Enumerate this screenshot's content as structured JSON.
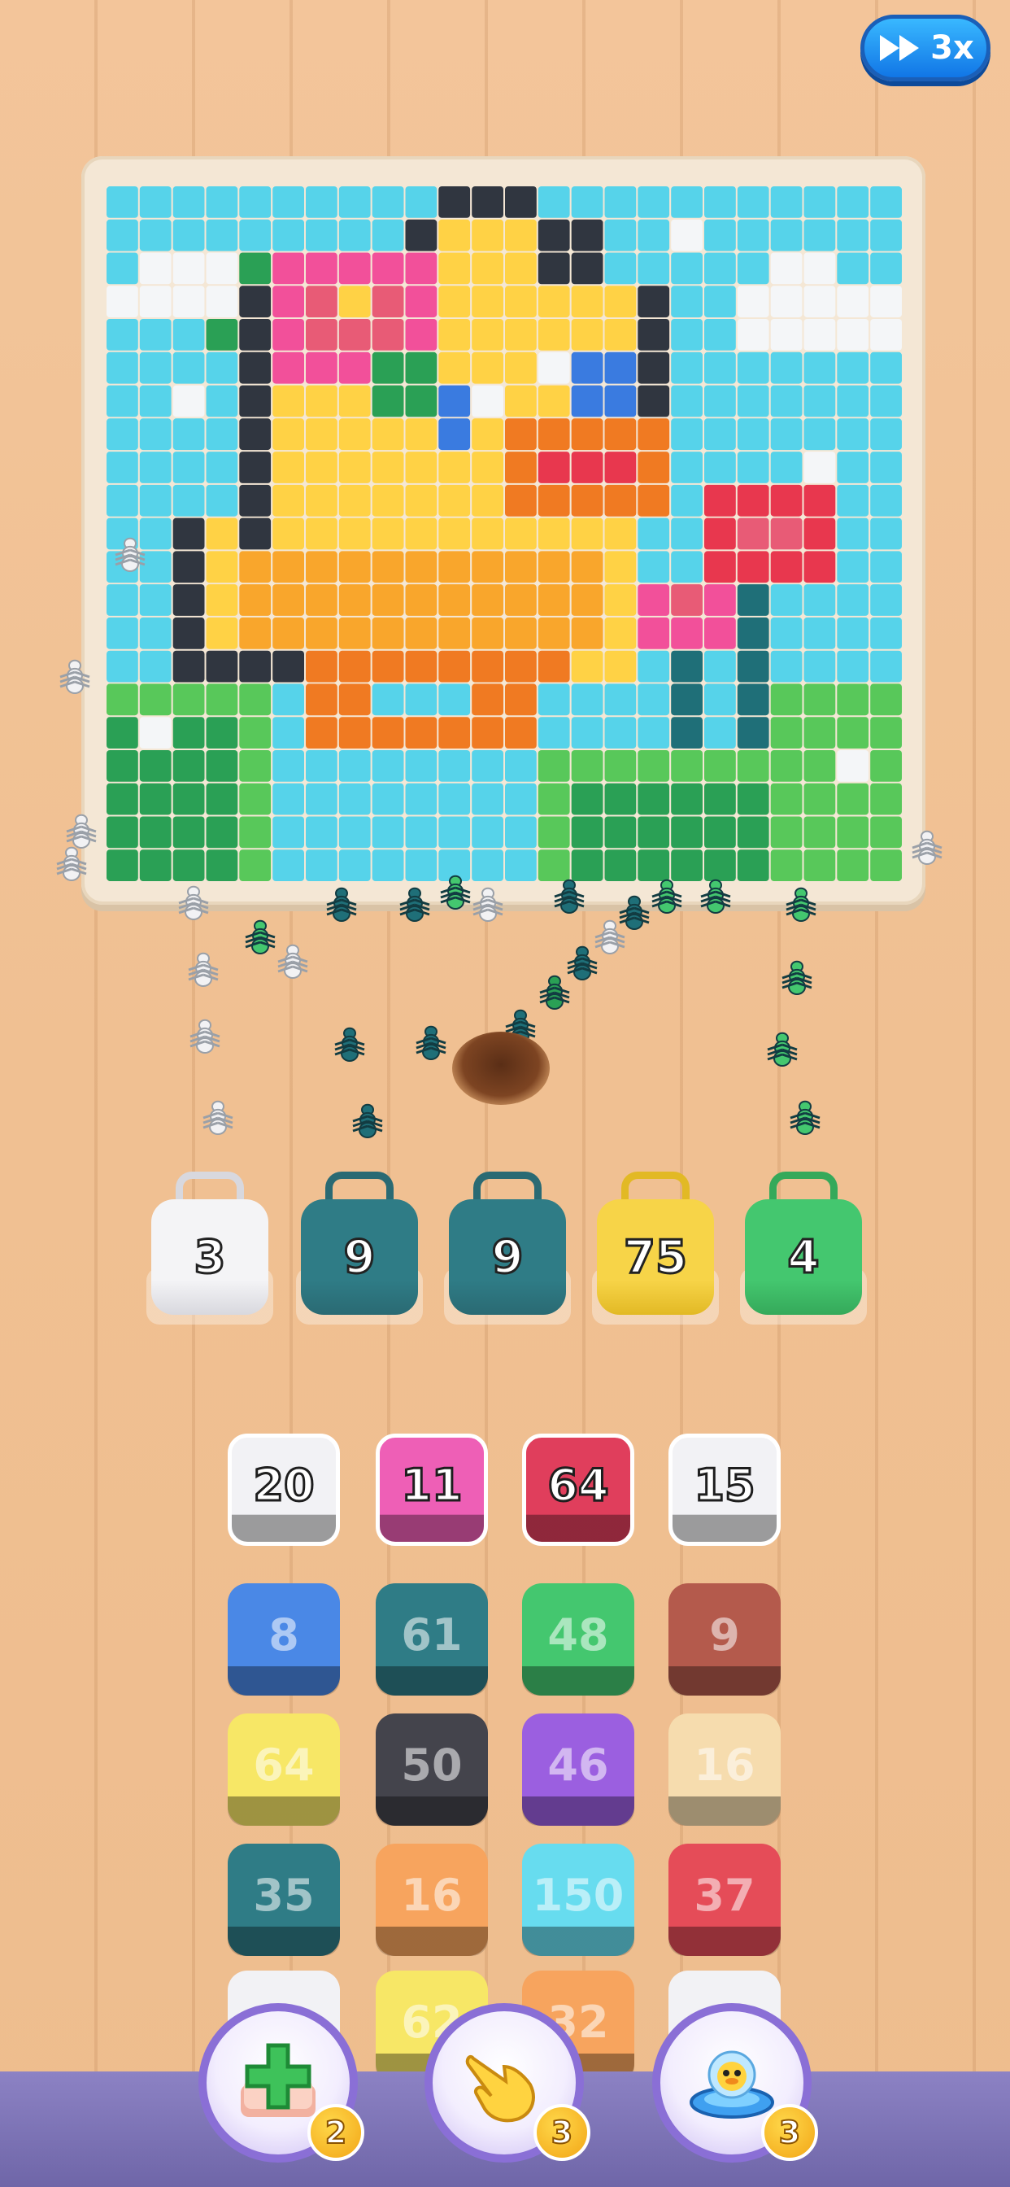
{
  "speed": {
    "label": "3x"
  },
  "buckets": [
    {
      "value": "3",
      "color": "#f4f4f6",
      "handle": "#d8d8de"
    },
    {
      "value": "9",
      "color": "#2f7c86",
      "handle": "#2a6a73"
    },
    {
      "value": "9",
      "color": "#2f7c86",
      "handle": "#2a6a73"
    },
    {
      "value": "75",
      "color": "#f7d448",
      "handle": "#e2b925"
    },
    {
      "value": "4",
      "color": "#44c76f",
      "handle": "#35a95a"
    }
  ],
  "tiles": [
    [
      {
        "value": "20",
        "color": "#f2f2f5",
        "state": "active"
      },
      {
        "value": "11",
        "color": "#ee5fb6",
        "state": "active"
      },
      {
        "value": "64",
        "color": "#e03e5c",
        "state": "active"
      },
      {
        "value": "15",
        "color": "#f2f2f5",
        "state": "active"
      }
    ],
    [
      {
        "value": "8",
        "color": "#4a88e6",
        "state": "dim"
      },
      {
        "value": "61",
        "color": "#2f7c86",
        "state": "dim"
      },
      {
        "value": "48",
        "color": "#44c76f",
        "state": "dim"
      },
      {
        "value": "9",
        "color": "#b45a4c",
        "state": "dim"
      }
    ],
    [
      {
        "value": "64",
        "color": "#f7e766",
        "state": "dim"
      },
      {
        "value": "50",
        "color": "#44444c",
        "state": "dim"
      },
      {
        "value": "46",
        "color": "#9b5fe0",
        "state": "dim"
      },
      {
        "value": "16",
        "color": "#f6dcae",
        "state": "dim"
      }
    ],
    [
      {
        "value": "35",
        "color": "#2f7c86",
        "state": "dim"
      },
      {
        "value": "16",
        "color": "#f7a45e",
        "state": "dim"
      },
      {
        "value": "150",
        "color": "#67dcef",
        "state": "dim"
      },
      {
        "value": "37",
        "color": "#e54c58",
        "state": "dim"
      }
    ],
    [
      {
        "value": "",
        "color": "#f2f2f5",
        "state": "dim"
      },
      {
        "value": "62",
        "color": "#f7e766",
        "state": "dim"
      },
      {
        "value": "32",
        "color": "#f7a45e",
        "state": "dim"
      },
      {
        "value": "",
        "color": "#f2f2f5",
        "state": "dim"
      }
    ]
  ],
  "boosters": [
    {
      "name": "add-slot",
      "count": "2"
    },
    {
      "name": "tap-hand",
      "count": "3"
    },
    {
      "name": "ufo-duck",
      "count": "3"
    }
  ]
}
